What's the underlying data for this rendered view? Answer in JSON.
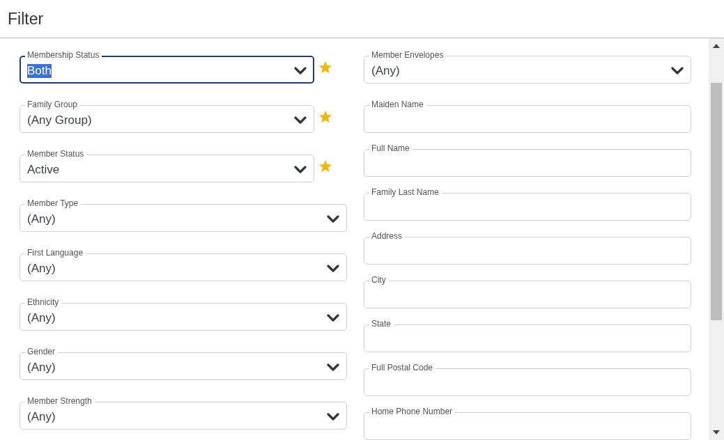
{
  "title": "Filter",
  "left_fields": [
    {
      "kind": "select",
      "label": "Membership Status",
      "value": "Both",
      "focused": true,
      "favorite": true
    },
    {
      "kind": "select",
      "label": "Family Group",
      "value": "(Any Group)",
      "focused": false,
      "favorite": true
    },
    {
      "kind": "select",
      "label": "Member Status",
      "value": "Active",
      "focused": false,
      "favorite": true
    },
    {
      "kind": "select",
      "label": "Member Type",
      "value": "(Any)",
      "focused": false,
      "favorite": false
    },
    {
      "kind": "select",
      "label": "First Language",
      "value": "(Any)",
      "focused": false,
      "favorite": false
    },
    {
      "kind": "select",
      "label": "Ethnicity",
      "value": "(Any)",
      "focused": false,
      "favorite": false
    },
    {
      "kind": "select",
      "label": "Gender",
      "value": "(Any)",
      "focused": false,
      "favorite": false
    },
    {
      "kind": "select",
      "label": "Member Strength",
      "value": "(Any)",
      "focused": false,
      "favorite": false
    }
  ],
  "right_fields": [
    {
      "kind": "select",
      "label": "Member Envelopes",
      "value": "(Any)",
      "focused": false,
      "favorite": false
    },
    {
      "kind": "text",
      "label": "Maiden Name",
      "focused": false,
      "favorite": false
    },
    {
      "kind": "text",
      "label": "Full Name",
      "focused": false,
      "favorite": false
    },
    {
      "kind": "text",
      "label": "Family Last Name",
      "focused": false,
      "favorite": false
    },
    {
      "kind": "text",
      "label": "Address",
      "focused": false,
      "favorite": false
    },
    {
      "kind": "text",
      "label": "City",
      "focused": false,
      "favorite": false
    },
    {
      "kind": "text",
      "label": "State",
      "focused": false,
      "favorite": false
    },
    {
      "kind": "text",
      "label": "Full Postal Code",
      "focused": false,
      "favorite": false
    },
    {
      "kind": "text",
      "label": "Home Phone Number",
      "focused": false,
      "favorite": false
    }
  ]
}
